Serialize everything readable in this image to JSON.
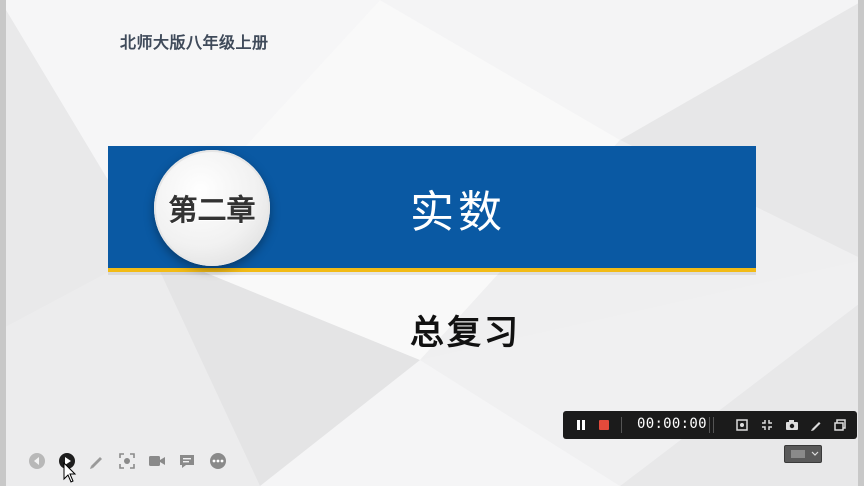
{
  "slide": {
    "edition": "北师大版八年级上册",
    "chapter_badge": "第二章",
    "chapter_title": "实数",
    "subtitle": "总复习"
  },
  "recorder": {
    "timer": "00:00:00",
    "icons": [
      "pause-icon",
      "stop-icon",
      "region-icon",
      "shrink-icon",
      "camera-icon",
      "pen-icon",
      "window-icon"
    ]
  },
  "presenter_toolbar": {
    "icons": [
      "back-icon",
      "play-icon",
      "pen-icon",
      "screenshot-icon",
      "video-icon",
      "comment-icon",
      "more-icon"
    ]
  },
  "colors": {
    "banner": "#0a59a3",
    "stripe": "#f2bb16",
    "stop": "#e34a3b"
  }
}
